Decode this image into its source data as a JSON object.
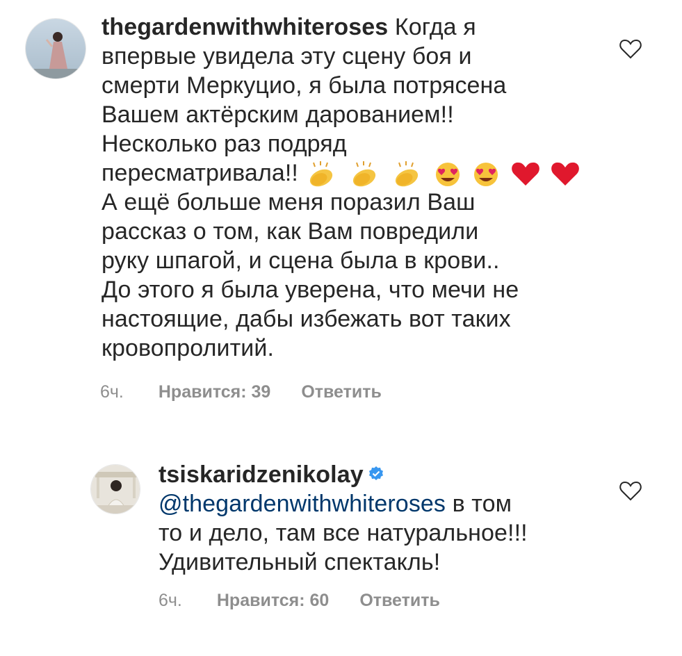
{
  "comments": [
    {
      "username": "thegardenwithwhiteroses",
      "text_lines": [
        "Когда я",
        "впервые увидела эту сцену боя и",
        "смерти Меркуцио, я была потрясена",
        "Вашем актёрским дарованием!!",
        "Несколько раз подряд",
        "пересматривала!!",
        "А ещё больше меня поразил Ваш",
        "рассказ о том, как Вам повредили",
        "руку шпагой, и сцена была в крови..",
        "До этого я была уверена, что мечи не",
        "настоящие, дабы избежать вот таких",
        "кровопролитий."
      ],
      "emojis": [
        "clapping-hands",
        "clapping-hands",
        "clapping-hands",
        "heart-eyes",
        "heart-eyes",
        "red-heart",
        "red-heart"
      ],
      "time": "6ч.",
      "likes": "Нравится: 39",
      "reply": "Ответить",
      "like_icon": "heart-outline-icon"
    },
    {
      "username": "tsiskaridzenikolay",
      "verified": true,
      "mention": "@thegardenwithwhiteroses",
      "text_lines": [
        "в том",
        "то и дело, там все натуральное!!!",
        "Удивительный спектакль!"
      ],
      "time": "6ч.",
      "likes": "Нравится: 60",
      "reply": "Ответить",
      "like_icon": "heart-outline-icon"
    }
  ],
  "colors": {
    "text": "#262626",
    "meta": "#8e8e8e",
    "mention": "#00376b",
    "verified": "#3897f0"
  }
}
